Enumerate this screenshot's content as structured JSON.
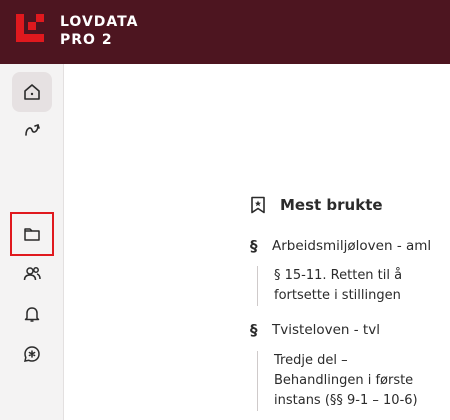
{
  "header": {
    "brand_line1": "LOVDATA",
    "brand_line2": "PRO 2",
    "brand_color": "#4d1520",
    "logo_color": "#e0191e"
  },
  "sidebar": {
    "items": [
      {
        "icon": "home-icon",
        "active": true
      },
      {
        "icon": "route-icon",
        "active": false
      },
      {
        "icon": "folder-icon",
        "active": false,
        "highlighted": true
      },
      {
        "icon": "users-icon",
        "active": false
      },
      {
        "icon": "bell-icon",
        "active": false
      },
      {
        "icon": "chat-star-icon",
        "active": false
      }
    ]
  },
  "panel": {
    "title": "Mest brukte",
    "title_icon": "bookmark-icon",
    "entries": [
      {
        "law": "Arbeidsmiljøloven - aml",
        "sub_lines": [
          "§ 15-11. Retten til å",
          "fortsette i stillingen"
        ]
      },
      {
        "law": "Tvisteloven - tvl",
        "sub_lines": [
          "Tredje del –",
          "Behandlingen i første",
          "instans (§§ 9-1 – 10-6)"
        ]
      }
    ],
    "section_symbol": "§"
  }
}
